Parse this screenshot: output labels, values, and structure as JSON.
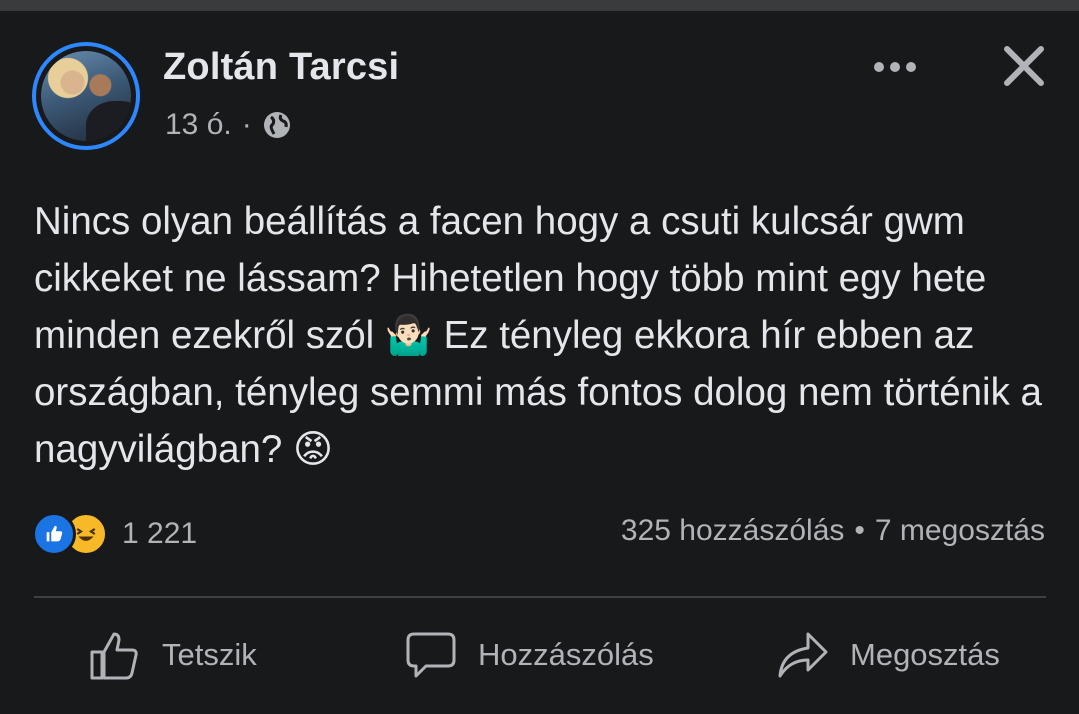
{
  "post": {
    "author": "Zoltán Tarcsi",
    "time": "13 ó.",
    "separator": "·",
    "privacy_icon": "globe-icon",
    "text": "Nincs olyan beállítás a facen hogy a csuti kulcsár gwm cikkeket ne lássam? Hihetetlen hogy több mint egy hete minden ezekről szól 🤷🏻‍♂️ Ez tényleg ekkora hír ebben az országban, tényleg semmi más fontos dolog nem történik a nagyvilágban? 😡"
  },
  "header_actions": {
    "more_icon": "more-dots-icon",
    "close_icon": "close-icon"
  },
  "engagement": {
    "reaction_icons": [
      "like-reaction-icon",
      "haha-reaction-icon"
    ],
    "reaction_count": "1 221",
    "comments": "325 hozzászólás",
    "dot": "•",
    "shares": "7 megosztás"
  },
  "actions": {
    "like_label": "Tetszik",
    "comment_label": "Hozzászólás",
    "share_label": "Megosztás"
  },
  "colors": {
    "background": "#18191a",
    "accent": "#2d88ff",
    "text": "#e4e6eb",
    "muted": "#b0b3b8"
  }
}
